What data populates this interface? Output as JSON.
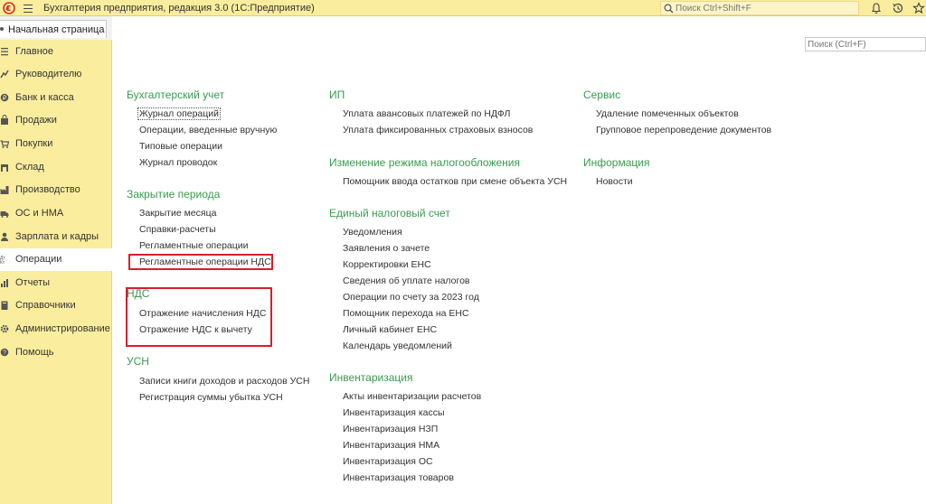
{
  "window": {
    "title": "Бухгалтерия предприятия, редакция 3.0  (1С:Предприятие)",
    "search_placeholder": "Поиск Ctrl+Shift+F",
    "icons": [
      "1c-logo-icon",
      "hamburger-menu-icon",
      "search-icon",
      "bell-icon",
      "history-icon",
      "star-icon"
    ]
  },
  "tabs": [
    {
      "label": "Начальная страница"
    }
  ],
  "sidebar": {
    "items": [
      {
        "label": "Главное",
        "icon": "list-icon"
      },
      {
        "label": "Руководителю",
        "icon": "chart-icon"
      },
      {
        "label": "Банк и касса",
        "icon": "bank-icon"
      },
      {
        "label": "Продажи",
        "icon": "bag-icon"
      },
      {
        "label": "Покупки",
        "icon": "cart-icon"
      },
      {
        "label": "Склад",
        "icon": "warehouse-icon"
      },
      {
        "label": "Производство",
        "icon": "factory-icon"
      },
      {
        "label": "ОС и НМА",
        "icon": "truck-icon"
      },
      {
        "label": "Зарплата и кадры",
        "icon": "people-icon"
      },
      {
        "label": "Операции",
        "icon": "operations-icon",
        "active": true
      },
      {
        "label": "Отчеты",
        "icon": "report-icon"
      },
      {
        "label": "Справочники",
        "icon": "book-icon"
      },
      {
        "label": "Администрирование",
        "icon": "gear-icon"
      },
      {
        "label": "Помощь",
        "icon": "help-icon"
      }
    ]
  },
  "main": {
    "search_placeholder": "Поиск (Ctrl+F)",
    "columns": [
      {
        "sections": [
          {
            "title": "Бухгалтерский учет",
            "links": [
              "Журнал операций",
              "Операции, введенные вручную",
              "Типовые операции",
              "Журнал проводок"
            ]
          },
          {
            "title": "Закрытие периода",
            "links": [
              "Закрытие месяца",
              "Справки-расчеты",
              "Регламентные операции",
              "Регламентные операции НДС"
            ]
          },
          {
            "title": "НДС",
            "links": [
              "Отражение начисления НДС",
              "Отражение НДС к вычету"
            ]
          },
          {
            "title": "УСН",
            "links": [
              "Записи книги доходов и расходов УСН",
              "Регистрация суммы убытка УСН"
            ]
          }
        ]
      },
      {
        "sections": [
          {
            "title": "ИП",
            "links": [
              "Уплата авансовых платежей по НДФЛ",
              "Уплата фиксированных страховых взносов"
            ]
          },
          {
            "title": "Изменение режима налогообложения",
            "links": [
              "Помощник ввода остатков при смене объекта УСН"
            ]
          },
          {
            "title": "Единый налоговый счет",
            "links": [
              "Уведомления",
              "Заявления о зачете",
              "Корректировки ЕНС",
              "Сведения об уплате налогов",
              "Операции по счету за 2023 год",
              "Помощник перехода на ЕНС",
              "Личный кабинет ЕНС",
              "Календарь уведомлений"
            ]
          },
          {
            "title": "Инвентаризация",
            "links": [
              "Акты инвентаризации расчетов",
              "Инвентаризация кассы",
              "Инвентаризация НЗП",
              "Инвентаризация НМА",
              "Инвентаризация ОС",
              "Инвентаризация товаров"
            ]
          }
        ]
      },
      {
        "sections": [
          {
            "title": "Сервис",
            "links": [
              "Удаление помеченных объектов",
              "Групповое перепроведение документов"
            ]
          },
          {
            "title": "Информация",
            "links": [
              "Новости"
            ]
          }
        ]
      }
    ]
  },
  "colors": {
    "panel": "#fbed9e",
    "section_heading": "#3a9a4f",
    "highlight_box": "#d4202c"
  }
}
